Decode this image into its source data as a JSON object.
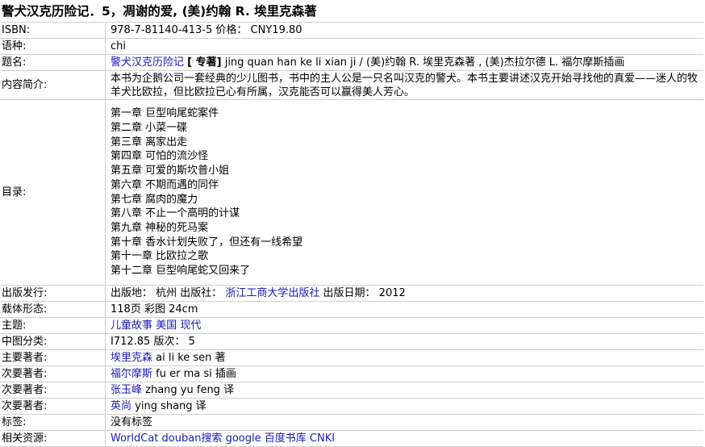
{
  "title": "警犬汉克历险记．5，凋谢的爱, (美)约翰 R. 埃里克森著",
  "rows": {
    "isbn": {
      "label": "ISBN:",
      "value": "978-7-81140-413-5 价格： CNY19.80"
    },
    "lang": {
      "label": "语种:",
      "value": "chi"
    },
    "titlefield": {
      "label": "题名:",
      "link": "警犬汉克历险记",
      "bold": "[ 专著]",
      "rest": " jing quan han ke li xian ji / (美)约翰 R. 埃里克森著 , (美)杰拉尔德 L. 福尔摩斯插画"
    },
    "summary": {
      "label": "内容简介:",
      "value": "本书为企鹅公司一套经典的少儿图书，书中的主人公是一只名叫汉克的警犬。本书主要讲述汉克开始寻找他的真爱——迷人的牧羊犬比欧拉，但比欧拉已心有所属，汉克能否可以赢得美人芳心。"
    },
    "toc": {
      "label": "目录:",
      "chapters": [
        "第一章 巨型响尾蛇案件",
        "第二章 小菜一碟",
        "第三章 离家出走",
        "第四章 可怕的流沙怪",
        "第五章 可爱的斯坎普小姐",
        "第六章 不期而遇的同伴",
        "第七章 腐肉的魔力",
        "第八章 不止一个高明的计谋",
        "第九章 神秘的死马案",
        "第十章 香水计划失败了，但还有一线希望",
        "第十一章 比欧拉之歌",
        "第十二章 巨型响尾蛇又回来了"
      ]
    },
    "publish": {
      "label": "出版发行:",
      "prefix": "出版地： 杭州 出版社： ",
      "publisher": "浙江工商大学出版社",
      "suffix": " 出版日期： 2012"
    },
    "form": {
      "label": "载体形态:",
      "value": "118页 彩图 24cm"
    },
    "subject": {
      "label": "主题:",
      "links": [
        "儿童故事",
        "美国",
        "现代"
      ]
    },
    "classification": {
      "label": "中图分类:",
      "value": "I712.85 版次： 5"
    },
    "author_main": {
      "label": "主要著者:",
      "link": "埃里克森",
      "rest": " ai li ke sen 著"
    },
    "author2": {
      "label": "次要著者:",
      "link": "福尔摩斯",
      "rest": " fu er ma si 插画"
    },
    "author3": {
      "label": "次要著者:",
      "link": "张玉峰",
      "rest": " zhang yu feng 译"
    },
    "author4": {
      "label": "次要著者:",
      "link": "英尚",
      "rest": " ying shang 译"
    },
    "tags": {
      "label": "标签:",
      "value": "没有标签"
    },
    "resources": {
      "label": "相关资源:",
      "links": [
        "WorldCat",
        "douban搜索",
        "google",
        "百度书库",
        "CNKI"
      ]
    }
  },
  "colors": {
    "link": "#1a1ab2",
    "border": "#cfcfcf"
  }
}
